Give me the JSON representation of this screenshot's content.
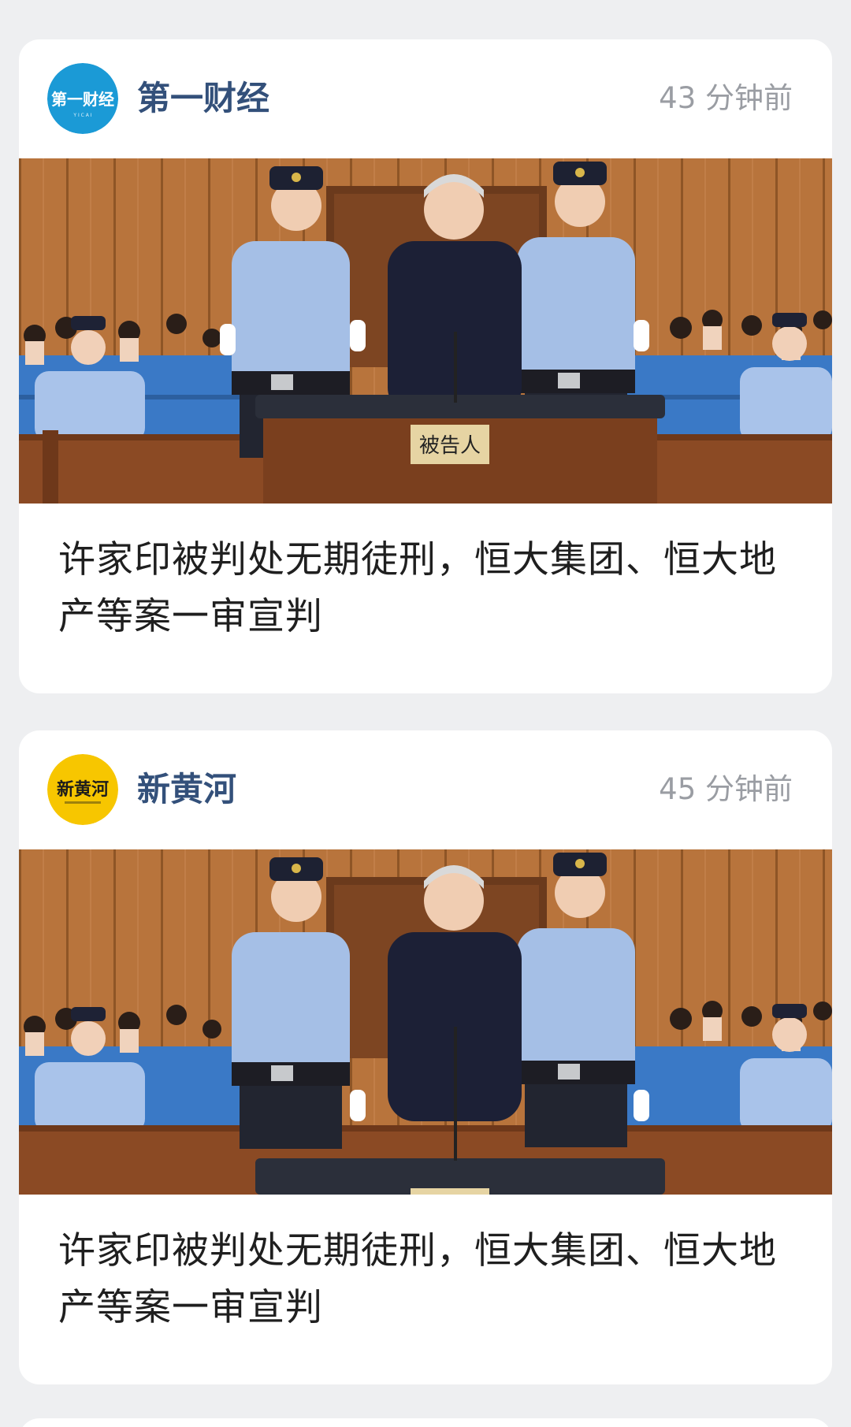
{
  "feed": {
    "items": [
      {
        "source": "第一财经",
        "logo_text": "第一财经",
        "time": "43 分钟前",
        "photo_sign": "被告人",
        "headline": "许家印被判处无期徒刑，恒大集团、恒大地产等案一审宣判",
        "logo_color": "#1b9ad6"
      },
      {
        "source": "新黄河",
        "logo_text": "新黄河",
        "time": "45 分钟前",
        "photo_sign": "",
        "headline": "许家印被判处无期徒刑，恒大集团、恒大地产等案一审宣判",
        "logo_color": "#f7c600"
      }
    ]
  }
}
